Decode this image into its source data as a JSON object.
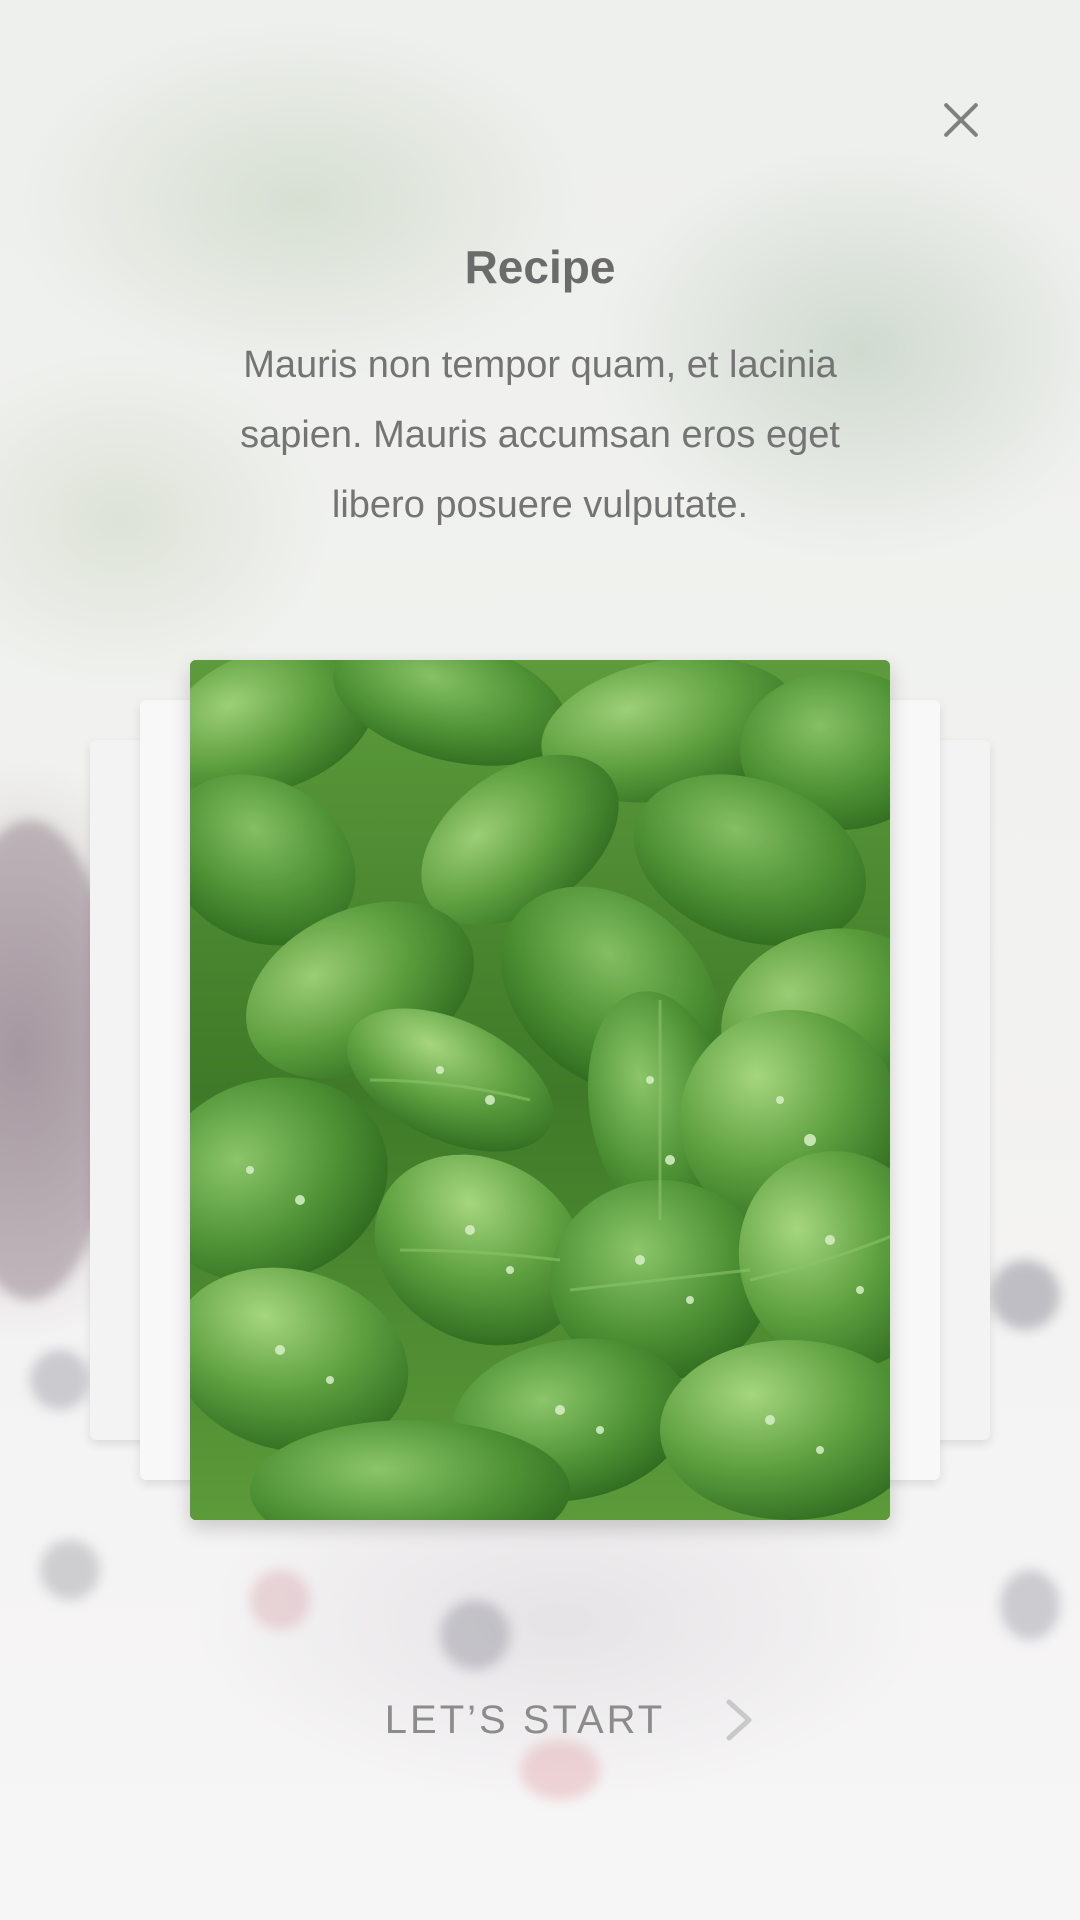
{
  "header": {
    "close_icon": "close-icon"
  },
  "content": {
    "title": "Recipe",
    "description": "Mauris non tempor quam, et lacinia sapien. Mauris accumsan eros eget libero posuere vulputate."
  },
  "card": {
    "image_subject": "fresh green spinach leaves with water droplets"
  },
  "footer": {
    "start_label": "LET’S START",
    "chevron_icon": "chevron-right-icon"
  },
  "colors": {
    "text_title": "#6b6b6b",
    "text_body": "#747474",
    "text_button": "#8c8c8c",
    "leaf_dark": "#2f6a1f",
    "leaf_mid": "#4e9235",
    "leaf_light": "#8cc56a"
  }
}
